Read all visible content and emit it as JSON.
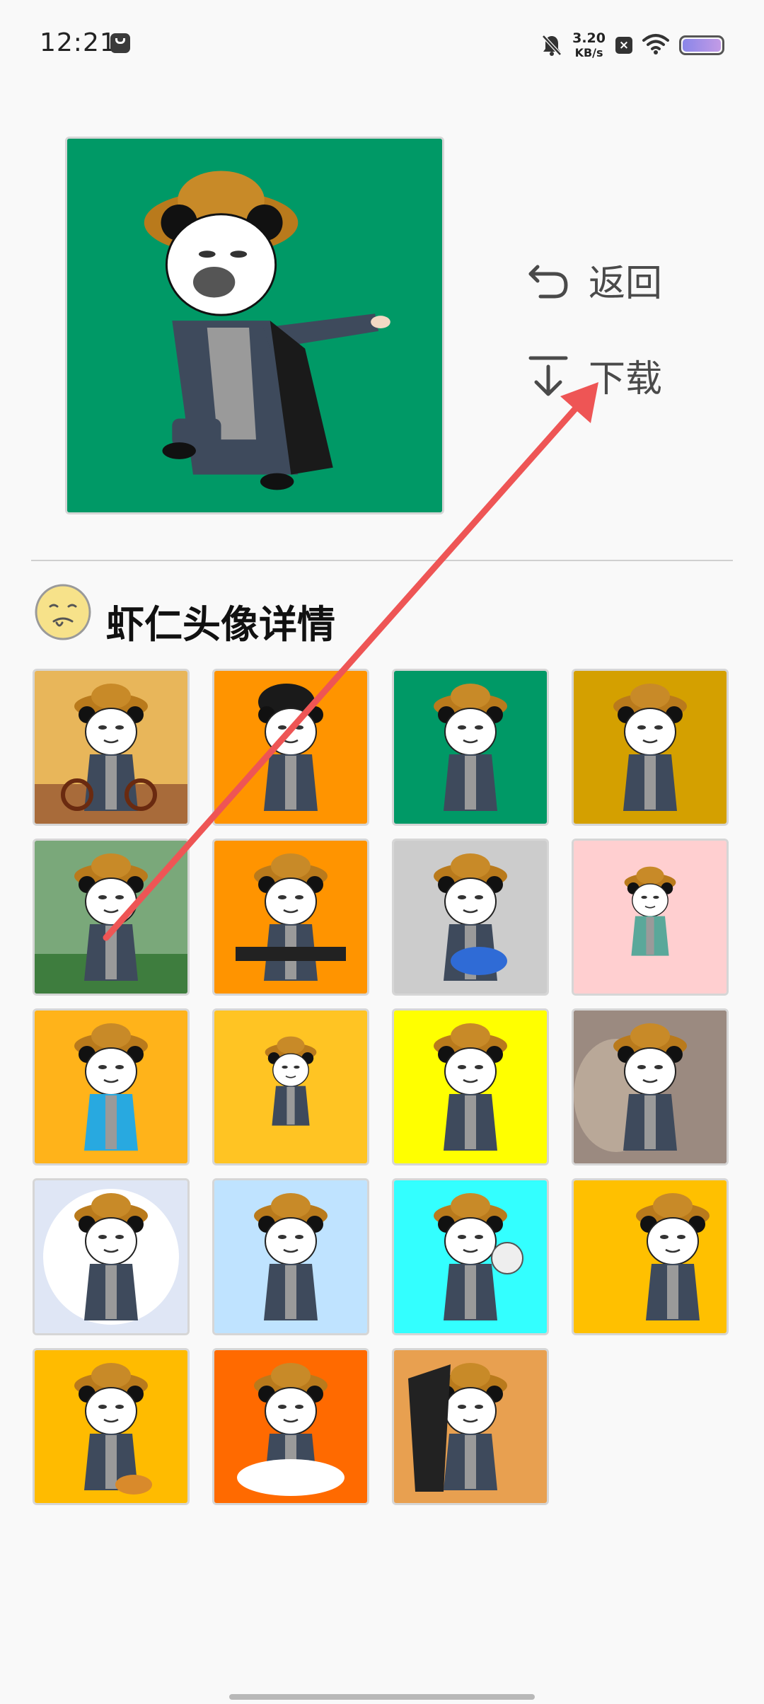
{
  "status_bar": {
    "time": "12:21",
    "network_speed_value": "3.20",
    "network_speed_unit": "KB/s",
    "icons": [
      "message-icon",
      "bell-off-icon",
      "close-box-icon",
      "wifi-icon",
      "battery-icon"
    ]
  },
  "preview": {
    "background": "#009966",
    "icon": "panda-meme-image"
  },
  "actions": {
    "back_label": "返回",
    "download_label": "下载"
  },
  "section": {
    "title": "虾仁头像详情",
    "icon": "drooling-face-icon"
  },
  "grid": {
    "tiles": [
      {
        "bg": "#e8b65a",
        "kind": "tricycle"
      },
      {
        "bg": "#ff9400",
        "kind": "hair"
      },
      {
        "bg": "#009966",
        "kind": "pointing"
      },
      {
        "bg": "#d4a000",
        "kind": "standing"
      },
      {
        "bg": "#7aa87a",
        "kind": "flower"
      },
      {
        "bg": "#ff9400",
        "kind": "bbq"
      },
      {
        "bg": "#cccccc",
        "kind": "scooter"
      },
      {
        "bg": "#ffcfd0",
        "kind": "small-standing"
      },
      {
        "bg": "#ffb31a",
        "kind": "blue-shirt"
      },
      {
        "bg": "#ffc423",
        "kind": "cat"
      },
      {
        "bg": "#ffff00",
        "kind": "surprised"
      },
      {
        "bg": "#6e5a55",
        "kind": "lion"
      },
      {
        "bg": "#dfe6f5",
        "kind": "moon"
      },
      {
        "bg": "#bfe3ff",
        "kind": "crane"
      },
      {
        "bg": "#33ffff",
        "kind": "duo"
      },
      {
        "bg": "#ffc000",
        "kind": "muscle"
      },
      {
        "bg": "#ffbb00",
        "kind": "burger"
      },
      {
        "bg": "#ff6a00",
        "kind": "bathtub"
      },
      {
        "bg": "#e8a050",
        "kind": "dragon"
      }
    ]
  },
  "annotation": {
    "color": "#ee5555"
  }
}
